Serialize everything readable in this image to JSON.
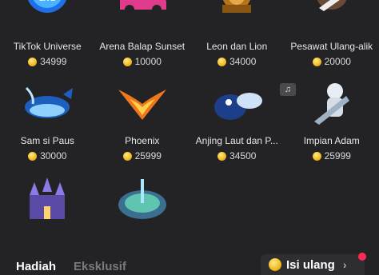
{
  "gifts": [
    {
      "name": "TikTok Universe",
      "price": "34999",
      "icon": "tiktok-universe-icon"
    },
    {
      "name": "Arena Balap Sunset",
      "price": "10000",
      "icon": "race-car-icon"
    },
    {
      "name": "Leon dan Lion",
      "price": "34000",
      "icon": "lion-icon"
    },
    {
      "name": "Pesawat Ulang-alik",
      "price": "20000",
      "icon": "space-shuttle-icon"
    },
    {
      "name": "Sam si Paus",
      "price": "30000",
      "icon": "whale-icon"
    },
    {
      "name": "Phoenix",
      "price": "25999",
      "icon": "phoenix-icon"
    },
    {
      "name": "Anjing Laut dan P...",
      "price": "34500",
      "icon": "seal-icon"
    },
    {
      "name": "Impian Adam",
      "price": "25999",
      "icon": "astronaut-icon"
    },
    {
      "name": "",
      "price": "",
      "icon": "castle-icon"
    },
    {
      "name": "",
      "price": "",
      "icon": "fountain-icon"
    }
  ],
  "music_badge": "♫",
  "tabs": {
    "active": "Hadiah",
    "inactive": "Eksklusif"
  },
  "recharge": {
    "label": "Isi ulang",
    "chevron": "›"
  },
  "colors": {
    "background": "#232326",
    "coin": "#f2b91c",
    "notification": "#fe2c55"
  }
}
